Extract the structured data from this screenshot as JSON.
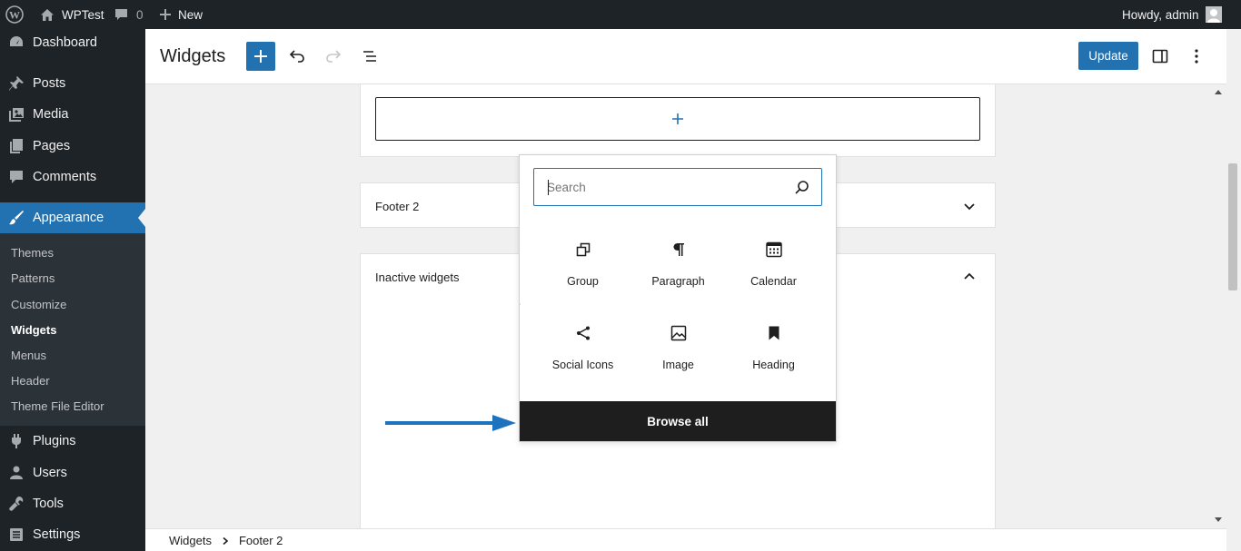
{
  "adminbar": {
    "site_name": "WPTest",
    "comments_count": "0",
    "new_label": "New",
    "greeting": "Howdy, admin"
  },
  "sidebar": {
    "items": [
      {
        "label": "Dashboard",
        "icon": "dashboard-icon"
      },
      {
        "label": "Posts",
        "icon": "pushpin-icon"
      },
      {
        "label": "Media",
        "icon": "media-icon"
      },
      {
        "label": "Pages",
        "icon": "pages-icon"
      },
      {
        "label": "Comments",
        "icon": "comment-icon"
      },
      {
        "label": "Appearance",
        "icon": "paintbrush-icon"
      },
      {
        "label": "Plugins",
        "icon": "plugin-icon"
      },
      {
        "label": "Users",
        "icon": "users-icon"
      },
      {
        "label": "Tools",
        "icon": "wrench-icon"
      },
      {
        "label": "Settings",
        "icon": "settings-icon"
      }
    ],
    "submenu": [
      "Themes",
      "Patterns",
      "Customize",
      "Widgets",
      "Menus",
      "Header",
      "Theme File Editor"
    ],
    "active_color": "#2271b1"
  },
  "header": {
    "title": "Widgets",
    "update_label": "Update"
  },
  "canvas": {
    "footer2_title": "Footer 2",
    "inactive_title": "Inactive widgets"
  },
  "inserter": {
    "search_placeholder": "Search",
    "blocks": [
      {
        "label": "Group",
        "icon": "group-icon"
      },
      {
        "label": "Paragraph",
        "icon": "paragraph-icon"
      },
      {
        "label": "Calendar",
        "icon": "calendar-icon"
      },
      {
        "label": "Social Icons",
        "icon": "share-icon"
      },
      {
        "label": "Image",
        "icon": "image-icon"
      },
      {
        "label": "Heading",
        "icon": "bookmark-icon"
      }
    ],
    "browse_all_label": "Browse all"
  },
  "breadcrumb": {
    "items": [
      "Widgets",
      "Footer 2"
    ]
  },
  "colors": {
    "primary": "#2271b1",
    "admin_dark": "#1d2327",
    "arrow": "#1e73be"
  }
}
